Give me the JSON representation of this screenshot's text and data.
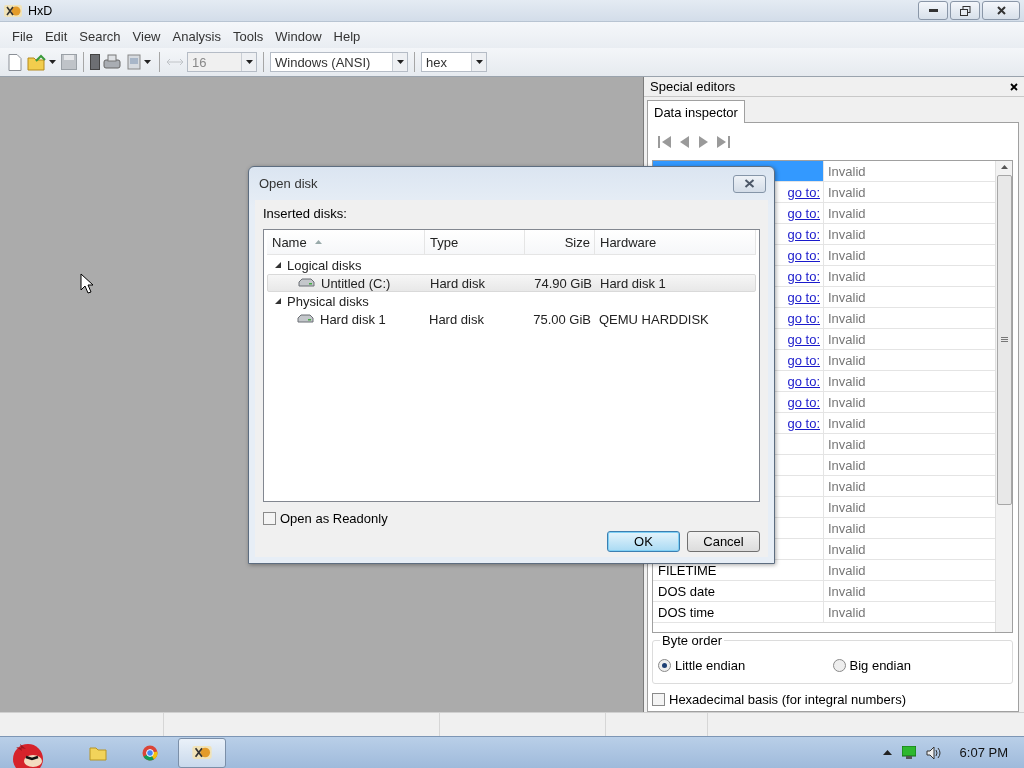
{
  "window": {
    "title": "HxD"
  },
  "menu": [
    "File",
    "Edit",
    "Search",
    "View",
    "Analysis",
    "Tools",
    "Window",
    "Help"
  ],
  "toolbar": {
    "combos": [
      {
        "value": "16",
        "disabled": true
      },
      {
        "value": "Windows (ANSI)",
        "disabled": false
      },
      {
        "value": "hex",
        "disabled": false
      }
    ]
  },
  "special_editors": {
    "title": "Special editors",
    "tabs": [
      {
        "label": "Data inspector",
        "selected": true
      }
    ],
    "rows": [
      {
        "value": "Invalid",
        "selected": true
      },
      {
        "link": "go to:",
        "value": "Invalid",
        "selected": false
      },
      {
        "link": "go to:",
        "value": "Invalid",
        "selected": false
      },
      {
        "link": "go to:",
        "value": "Invalid",
        "selected": false
      },
      {
        "link": "go to:",
        "value": "Invalid",
        "selected": false
      },
      {
        "link": "go to:",
        "value": "Invalid",
        "selected": false
      },
      {
        "link": "go to:",
        "value": "Invalid",
        "selected": false
      },
      {
        "link": "go to:",
        "value": "Invalid",
        "selected": false
      },
      {
        "link": "go to:",
        "value": "Invalid",
        "selected": false
      },
      {
        "link": "go to:",
        "value": "Invalid",
        "selected": false
      },
      {
        "link": "go to:",
        "value": "Invalid",
        "selected": false
      },
      {
        "link": "go to:",
        "value": "Invalid",
        "selected": false
      },
      {
        "link": "go to:",
        "value": "Invalid",
        "selected": false
      },
      {
        "value": "Invalid",
        "selected": false
      },
      {
        "value": "Invalid",
        "selected": false
      },
      {
        "value": "Invalid",
        "selected": false
      },
      {
        "value": "Invalid",
        "selected": false
      },
      {
        "value": "Invalid",
        "selected": false
      },
      {
        "value": "Invalid",
        "selected": false
      },
      {
        "name": "FILETIME",
        "value": "Invalid",
        "selected": false
      },
      {
        "name": "DOS date",
        "value": "Invalid",
        "selected": false
      },
      {
        "name": "DOS time",
        "value": "Invalid",
        "selected": false
      }
    ],
    "byte_order": {
      "label": "Byte order",
      "options": [
        {
          "label": "Little endian",
          "selected": true
        },
        {
          "label": "Big endian",
          "selected": false
        }
      ]
    },
    "hex_basis": {
      "label": "Hexadecimal basis (for integral numbers)",
      "checked": false
    }
  },
  "dialog": {
    "title": "Open disk",
    "list_label": "Inserted disks:",
    "columns": [
      {
        "label": "Name",
        "sorted": true
      },
      {
        "label": "Type",
        "sorted": false
      },
      {
        "label": "Size",
        "sorted": false
      },
      {
        "label": "Hardware",
        "sorted": false
      }
    ],
    "groups": [
      {
        "label": "Logical disks",
        "expanded": true,
        "children": [
          {
            "name": "Untitled (C:)",
            "type": "Hard disk",
            "size": "74.90 GiB",
            "hardware": "Hard disk 1",
            "selected": true
          }
        ]
      },
      {
        "label": "Physical disks",
        "expanded": true,
        "children": [
          {
            "name": "Hard disk 1",
            "type": "Hard disk",
            "size": "75.00 GiB",
            "hardware": "QEMU HARDDISK",
            "selected": false
          }
        ]
      }
    ],
    "readonly": {
      "label": "Open as Readonly",
      "checked": false
    },
    "buttons": [
      {
        "label": "OK",
        "default": true
      },
      {
        "label": "Cancel",
        "default": false
      }
    ]
  },
  "taskbar": {
    "items": [
      {
        "kind": "folder",
        "active": false
      },
      {
        "kind": "browser",
        "active": false
      },
      {
        "kind": "hxd",
        "active": true
      }
    ],
    "clock": "6:07 PM"
  }
}
